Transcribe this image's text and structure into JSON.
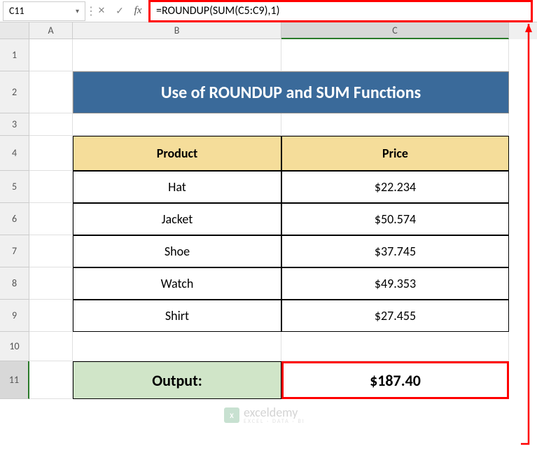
{
  "name_box": "C11",
  "formula": "=ROUNDUP(SUM(C5:C9),1)",
  "columns": {
    "A": "A",
    "B": "B",
    "C": "C"
  },
  "rows": [
    "1",
    "2",
    "3",
    "4",
    "5",
    "6",
    "7",
    "8",
    "9",
    "10",
    "11"
  ],
  "title": "Use of ROUNDUP and SUM Functions",
  "headers": {
    "product": "Product",
    "price": "Price"
  },
  "table": [
    {
      "product": "Hat",
      "price": "$22.234"
    },
    {
      "product": "Jacket",
      "price": "$50.574"
    },
    {
      "product": "Shoe",
      "price": "$37.745"
    },
    {
      "product": "Watch",
      "price": "$49.353"
    },
    {
      "product": "Shirt",
      "price": "$27.455"
    }
  ],
  "output": {
    "label": "Output:",
    "value": "$187.40"
  },
  "watermark": {
    "brand": "exceldemy",
    "tag": "EXCEL · DATA · BI"
  },
  "chart_data": {
    "type": "table",
    "title": "Use of ROUNDUP and SUM Functions",
    "columns": [
      "Product",
      "Price"
    ],
    "rows": [
      [
        "Hat",
        22.234
      ],
      [
        "Jacket",
        50.574
      ],
      [
        "Shoe",
        37.745
      ],
      [
        "Watch",
        49.353
      ],
      [
        "Shirt",
        27.455
      ]
    ],
    "formula": "=ROUNDUP(SUM(C5:C9),1)",
    "output": 187.4
  }
}
